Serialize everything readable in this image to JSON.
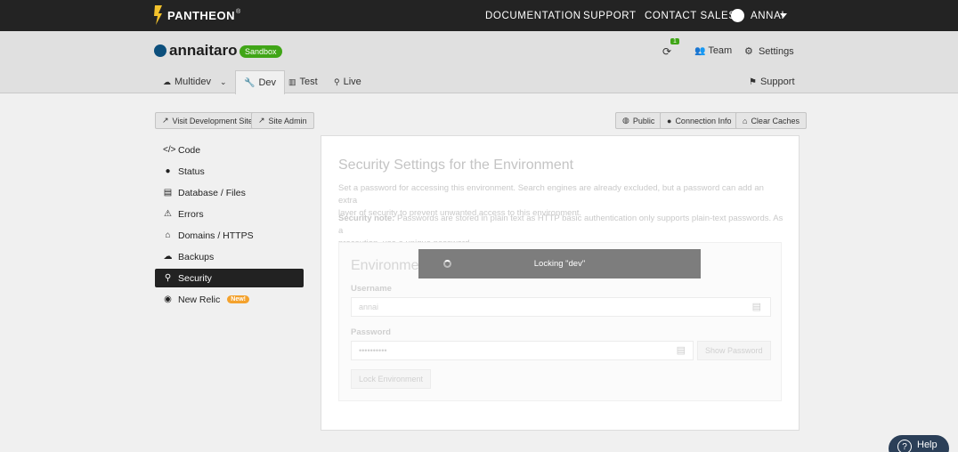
{
  "topbar": {
    "logo_text": "PANTHEON",
    "logo_mark": "®",
    "nav": [
      "DOCUMENTATION",
      "SUPPORT",
      "CONTACT SALES"
    ],
    "user_name": "ANNAI",
    "bg_color": "#232323"
  },
  "site": {
    "name": "annaitaro",
    "badge": "Sandbox",
    "notification_count": "1",
    "team_label": "Team",
    "settings_label": "Settings",
    "support_label": "Support"
  },
  "env_tabs": [
    {
      "label": "Multidev",
      "icon": "cloud-icon"
    },
    {
      "label": "Dev",
      "icon": "wrench-icon",
      "active": true
    },
    {
      "label": "Test",
      "icon": "chart-icon"
    },
    {
      "label": "Live",
      "icon": "person-running-icon"
    }
  ],
  "actions": {
    "visit_dev": "Visit Development Site",
    "site_admin": "Site Admin",
    "public": "Public",
    "connection_info": "Connection Info",
    "clear_caches": "Clear Caches"
  },
  "sidebar": {
    "items": [
      {
        "label": "Code",
        "icon": "code-icon"
      },
      {
        "label": "Status",
        "icon": "info-icon"
      },
      {
        "label": "Database / Files",
        "icon": "database-icon"
      },
      {
        "label": "Errors",
        "icon": "warning-icon"
      },
      {
        "label": "Domains / HTTPS",
        "icon": "home-icon"
      },
      {
        "label": "Backups",
        "icon": "cloud-upload-icon"
      },
      {
        "label": "Security",
        "icon": "security-icon",
        "active": true
      },
      {
        "label": "New Relic",
        "icon": "eye-icon",
        "badge": "New!"
      }
    ]
  },
  "security": {
    "title": "Security Settings for the Environment",
    "desc_line1": "Set a password for accessing this environment. Search engines are already excluded, but a password can add an extra",
    "desc_line2": "layer of security to prevent unwanted access to this environment.",
    "note_label": "Security note:",
    "note_line1": " Passwords are stored in plain text as HTTP basic authentication only supports plain-text passwords. As a",
    "note_line2": "precaution, use a unique password.",
    "lock_title": "Environment Access:",
    "username_label": "Username",
    "username_value": "annai",
    "password_label": "Password",
    "password_value": "••••••••••",
    "show_password": "Show Password",
    "lock_button": "Lock Environment"
  },
  "toast": {
    "message": "Locking \"dev\""
  },
  "help": {
    "label": "Help",
    "symbol": "?"
  },
  "colors": {
    "accent_green": "#40a517",
    "new_badge": "#f4a22d",
    "help_bg": "#2b3f58"
  }
}
